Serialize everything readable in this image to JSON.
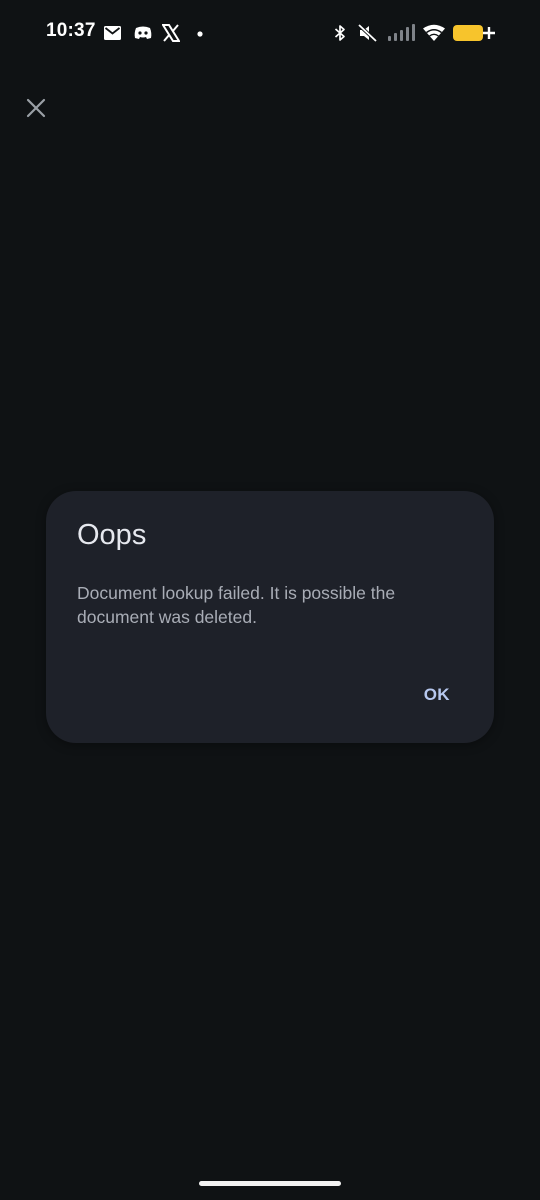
{
  "status_bar": {
    "time": "10:37",
    "left_icons": [
      "mail-icon",
      "discord-icon",
      "x-icon",
      "dot-icon"
    ],
    "right_icons": [
      "bluetooth-icon",
      "mute-icon",
      "signal-icon",
      "wifi-icon",
      "battery-charging-icon"
    ],
    "battery_color": "#f7c42c"
  },
  "toolbar": {
    "close_icon": "close-icon"
  },
  "dialog": {
    "title": "Oops",
    "message": "Document lookup failed. It is possible the document was deleted.",
    "ok_label": "OK"
  },
  "colors": {
    "background": "#0f1214",
    "dialog_background": "#1e2129",
    "accent": "#b7c8ef"
  }
}
